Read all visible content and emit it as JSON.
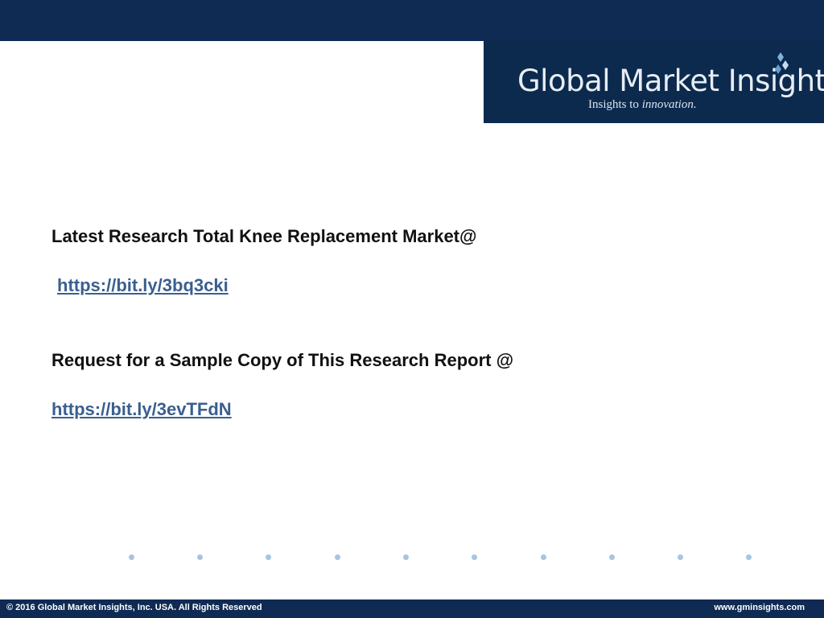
{
  "logo": {
    "name": "Global Market Insights",
    "tagline_prefix": "Insights to ",
    "tagline_emphasis": "innovation."
  },
  "content": {
    "heading_1": "Latest Research Total Knee Replacement Market@",
    "link_1": "https://bit.ly/3bq3cki",
    "heading_2": "Request for a Sample Copy of This Research Report @",
    "link_2": "https://bit.ly/3evTFdN"
  },
  "footer": {
    "copyright": "© 2016 Global Market Insights, Inc. USA.  All Rights Reserved",
    "website": "www.gminsights.com"
  },
  "colors": {
    "header_bar": "#0f2b54",
    "logo_bg": "#0b2a4e",
    "logo_accent": "#1a8fd0",
    "link": "#3a5f8f",
    "dot": "#a9c4dd"
  }
}
